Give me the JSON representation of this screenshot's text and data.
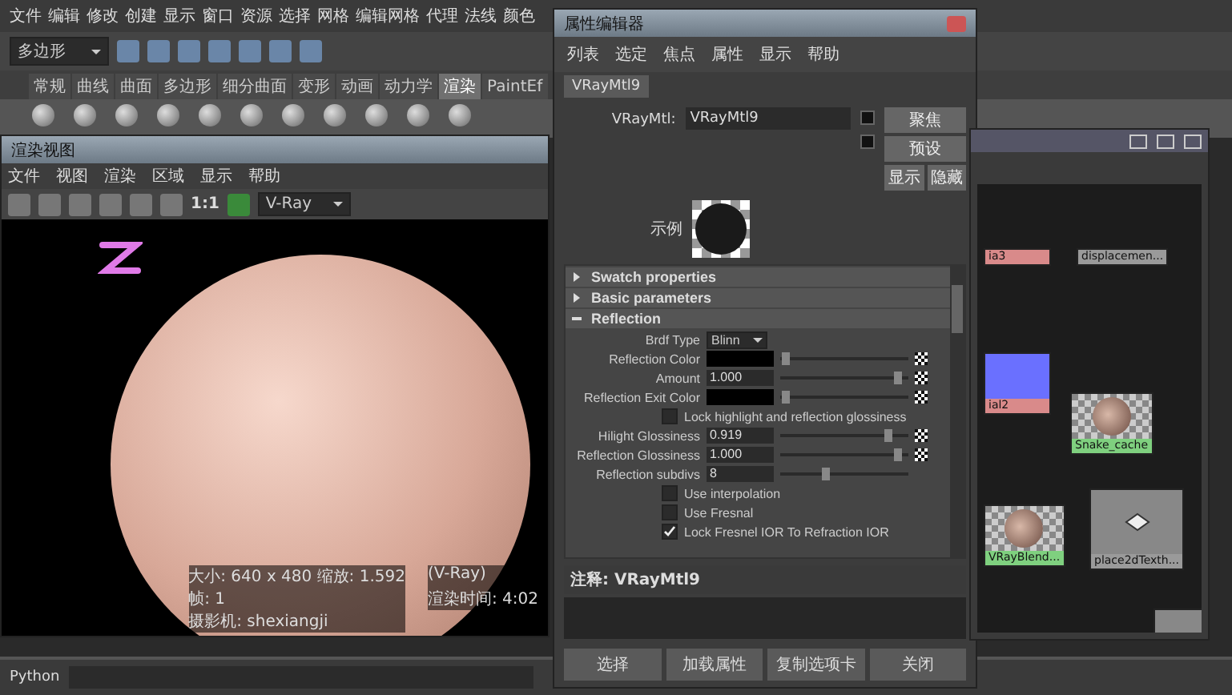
{
  "main_menu": [
    "文件",
    "编辑",
    "修改",
    "创建",
    "显示",
    "窗口",
    "资源",
    "选择",
    "网格",
    "编辑网格",
    "代理",
    "法线",
    "颜色"
  ],
  "mode_dropdown": "多边形",
  "shelf_tabs": [
    {
      "label": "常规",
      "selected": false
    },
    {
      "label": "曲线",
      "selected": false
    },
    {
      "label": "曲面",
      "selected": false
    },
    {
      "label": "多边形",
      "selected": false
    },
    {
      "label": "细分曲面",
      "selected": false
    },
    {
      "label": "变形",
      "selected": false
    },
    {
      "label": "动画",
      "selected": false
    },
    {
      "label": "动力学",
      "selected": false
    },
    {
      "label": "渲染",
      "selected": true
    },
    {
      "label": "PaintEf",
      "selected": false
    }
  ],
  "render_view": {
    "title": "渲染视图",
    "menu": [
      "文件",
      "视图",
      "渲染",
      "区域",
      "显示",
      "帮助"
    ],
    "ratio": "1:1",
    "renderer": "V-Ray",
    "stats": [
      "大小: 640 x 480 缩放: 1.592",
      "(V-Ray)",
      "帧: 1",
      "渲染时间: 4:02",
      "摄影机: shexiangji"
    ]
  },
  "attribute_editor": {
    "title": "属性编辑器",
    "menu": [
      "列表",
      "选定",
      "焦点",
      "属性",
      "显示",
      "帮助"
    ],
    "tab": "VRayMtl9",
    "node_label": "VRayMtl:",
    "node_name": "VRayMtl9",
    "side_buttons": [
      "聚焦",
      "预设",
      "显示",
      "隐藏"
    ],
    "sample_label": "示例",
    "sections": [
      {
        "label": "Swatch properties",
        "expanded": false
      },
      {
        "label": "Basic parameters",
        "expanded": false
      },
      {
        "label": "Reflection",
        "expanded": true
      }
    ],
    "rows": [
      {
        "kind": "dropdown",
        "label": "Brdf Type",
        "value": "Blinn"
      },
      {
        "kind": "color",
        "label": "Reflection Color",
        "level": 0.02
      },
      {
        "kind": "slider",
        "label": "Amount",
        "value": "1.000",
        "level": 0.95
      },
      {
        "kind": "color",
        "label": "Reflection Exit Color",
        "level": 0.02
      },
      {
        "kind": "checkbox",
        "label": "Lock highlight and reflection glossiness",
        "checked": false
      },
      {
        "kind": "slider",
        "label": "Hilight Glossiness",
        "value": "0.919",
        "level": 0.86
      },
      {
        "kind": "slider",
        "label": "Reflection Glossiness",
        "value": "1.000",
        "level": 0.95
      },
      {
        "kind": "int",
        "label": "Reflection subdivs",
        "value": "8",
        "level": 0.35
      },
      {
        "kind": "checkbox",
        "label": "Use interpolation",
        "checked": false
      },
      {
        "kind": "checkbox",
        "label": "Use Fresnal",
        "checked": false
      },
      {
        "kind": "checkbox",
        "label": "Lock Fresnel IOR To Refraction IOR",
        "checked": true
      }
    ],
    "notes": "注释: VRayMtl9",
    "bottom_buttons": [
      "选择",
      "加载属性",
      "复制选项卡",
      "关闭"
    ]
  },
  "hypershade": {
    "nodes": [
      {
        "kind": "plain",
        "label": "ia3",
        "color": "#d98a8a"
      },
      {
        "kind": "plain",
        "label": "displacemen...",
        "color": "#9a9a9a"
      },
      {
        "kind": "swatch",
        "label": "ial2",
        "color": "#d98a8a"
      },
      {
        "kind": "sphere",
        "label": "Snake_cache",
        "color": "#7fd07f"
      },
      {
        "kind": "sphere",
        "label": "VRayBlend...",
        "color": "#7fd07f"
      },
      {
        "kind": "texture",
        "label": "place2dTexth...",
        "color": "#9a9a9a"
      },
      {
        "kind": "texture"
      }
    ]
  },
  "python_label": "Python"
}
